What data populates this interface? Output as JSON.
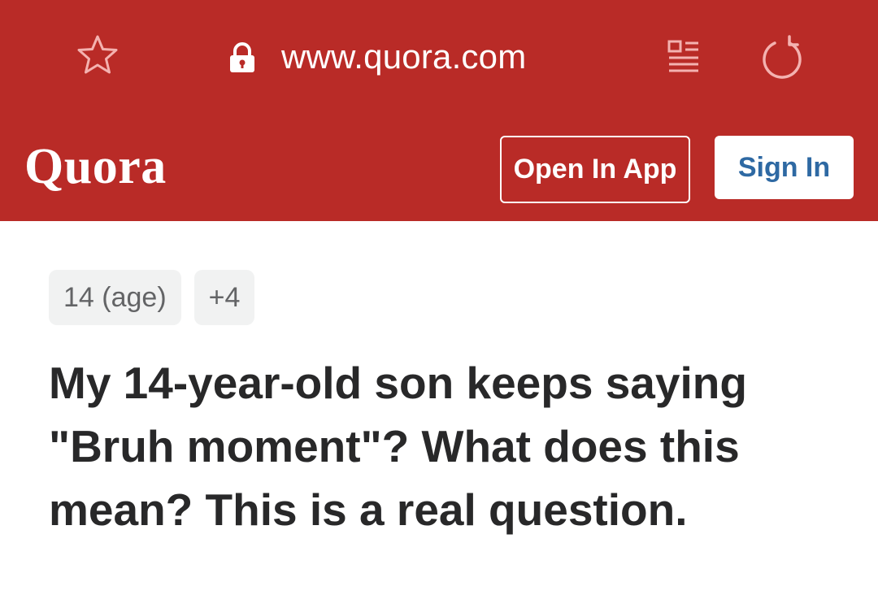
{
  "browser": {
    "url": "www.quora.com",
    "icons": {
      "favorite": "star-icon",
      "secure": "lock-icon",
      "reader": "reader-mode-icon",
      "reload": "reload-icon"
    }
  },
  "header": {
    "logo": "Quora",
    "open_in_app_label": "Open In App",
    "sign_in_label": "Sign In"
  },
  "question": {
    "topics": [
      "14 (age)",
      "+4"
    ],
    "title": "My 14-year-old son keeps saying \"Bruh moment\"? What does this mean? This is a real question."
  },
  "colors": {
    "brand_red": "#b92b27",
    "sign_in_text": "#2e69a3",
    "chip_bg": "#f1f2f2",
    "title_text": "#282829"
  }
}
